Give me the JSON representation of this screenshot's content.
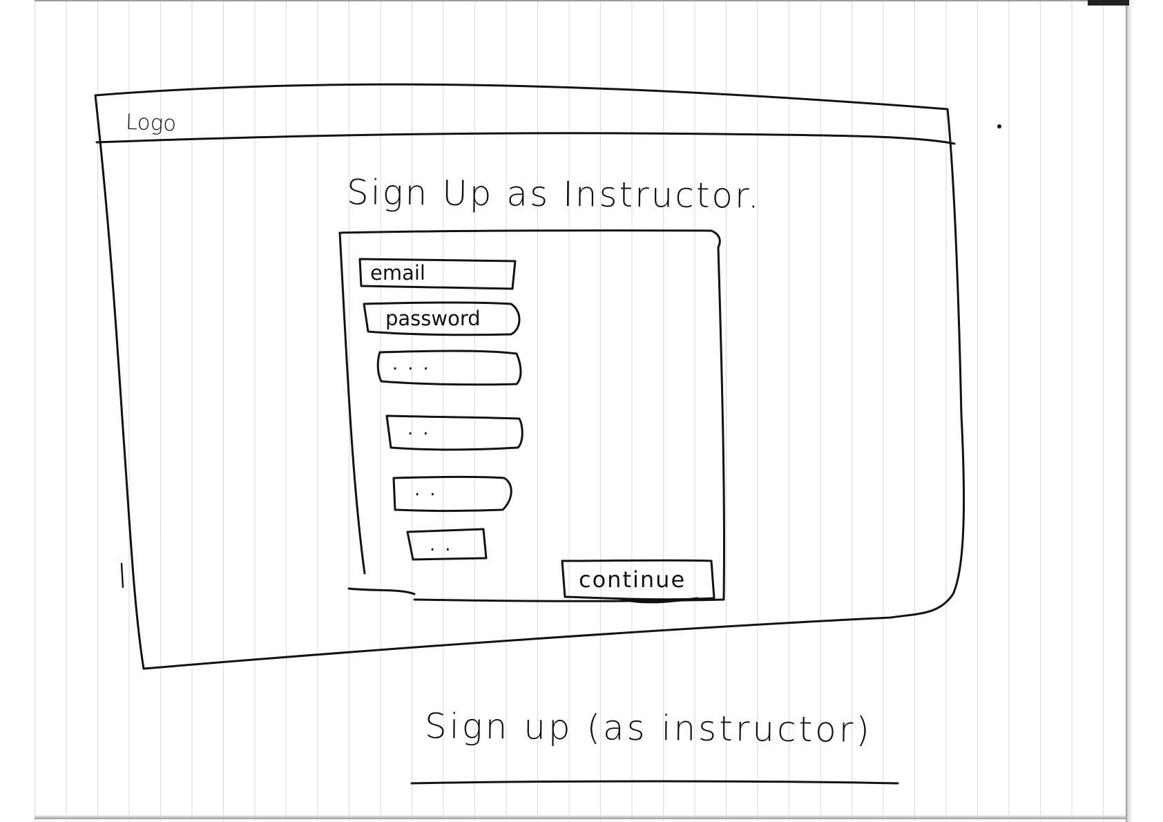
{
  "header": {
    "logo": "Logo"
  },
  "form": {
    "title": "Sign Up as Instructor.",
    "fields": [
      {
        "label": "email"
      },
      {
        "label": "password"
      },
      {
        "placeholder": "..."
      },
      {
        "placeholder": ".."
      },
      {
        "placeholder": ".."
      },
      {
        "placeholder": ".."
      }
    ],
    "continue_label": "continue"
  },
  "caption": "Sign up (as instructor)"
}
